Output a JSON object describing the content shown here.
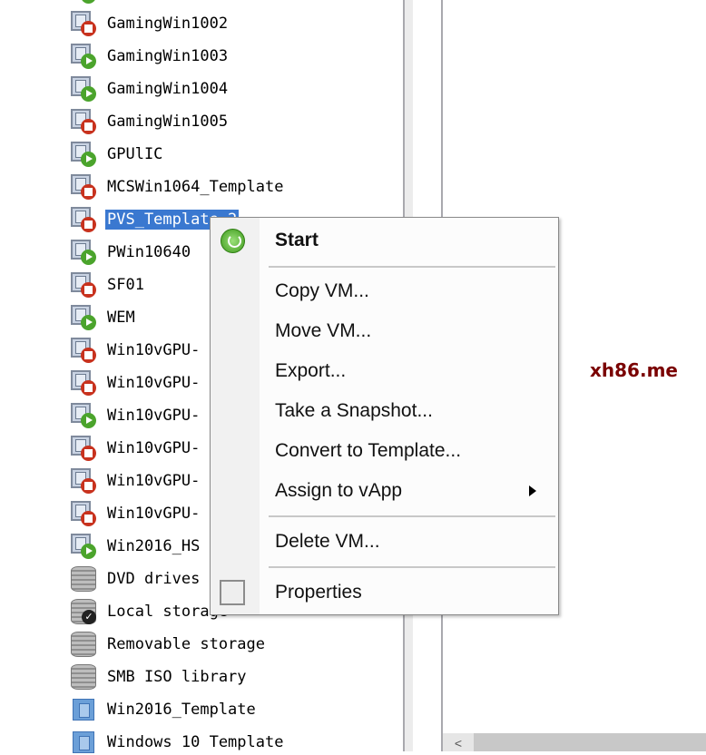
{
  "tree": {
    "items": [
      {
        "label": "",
        "icon": "vm-running-icon",
        "status": "run"
      },
      {
        "label": "GamingWin1002",
        "icon": "vm-stopped-icon",
        "status": "stop"
      },
      {
        "label": "GamingWin1003",
        "icon": "vm-running-icon",
        "status": "run"
      },
      {
        "label": "GamingWin1004",
        "icon": "vm-running-icon",
        "status": "run"
      },
      {
        "label": "GamingWin1005",
        "icon": "vm-stopped-icon",
        "status": "stop"
      },
      {
        "label": "GPUlIC",
        "icon": "vm-running-icon",
        "status": "run"
      },
      {
        "label": "MCSWin1064_Template",
        "icon": "vm-stopped-icon",
        "status": "stop"
      },
      {
        "label": "PVS_Template_2",
        "icon": "vm-stopped-icon",
        "status": "stop",
        "selected": true
      },
      {
        "label": "PWin10640",
        "icon": "vm-running-icon",
        "status": "run"
      },
      {
        "label": "SF01",
        "icon": "vm-stopped-icon",
        "status": "stop"
      },
      {
        "label": "WEM",
        "icon": "vm-running-icon",
        "status": "run"
      },
      {
        "label": "Win10vGPU-",
        "icon": "vm-stopped-icon",
        "status": "stop"
      },
      {
        "label": "Win10vGPU-",
        "icon": "vm-stopped-icon",
        "status": "stop"
      },
      {
        "label": "Win10vGPU-",
        "icon": "vm-running-icon",
        "status": "run"
      },
      {
        "label": "Win10vGPU-",
        "icon": "vm-stopped-icon",
        "status": "stop"
      },
      {
        "label": "Win10vGPU-",
        "icon": "vm-stopped-icon",
        "status": "stop"
      },
      {
        "label": "Win10vGPU-",
        "icon": "vm-stopped-icon",
        "status": "stop"
      },
      {
        "label": "Win2016_HS",
        "icon": "vm-running-icon",
        "status": "run"
      },
      {
        "label": "DVD drives",
        "icon": "storage-icon",
        "status": "disk"
      },
      {
        "label": "Local storage",
        "icon": "default-storage-icon",
        "status": "diskdefault"
      },
      {
        "label": "Removable storage",
        "icon": "storage-icon",
        "status": "disk"
      },
      {
        "label": "SMB ISO library",
        "icon": "storage-icon",
        "status": "disk"
      },
      {
        "label": "Win2016_Template",
        "icon": "template-icon",
        "status": "tpl"
      },
      {
        "label": "Windows 10 Template",
        "icon": "template-icon",
        "status": "tpl"
      }
    ]
  },
  "context_menu": {
    "start": "Start",
    "copy": "Copy VM...",
    "move": "Move VM...",
    "export": "Export...",
    "snapshot": "Take a Snapshot...",
    "convert": "Convert to Template...",
    "assign": "Assign to vApp",
    "delete": "Delete VM...",
    "properties": "Properties"
  },
  "watermark": "xh86.me",
  "scrollbar": {
    "left_arrow": "<"
  },
  "colors": {
    "selection": "#3a78d0",
    "stopped": "#c8321e",
    "running": "#4ba42c"
  }
}
